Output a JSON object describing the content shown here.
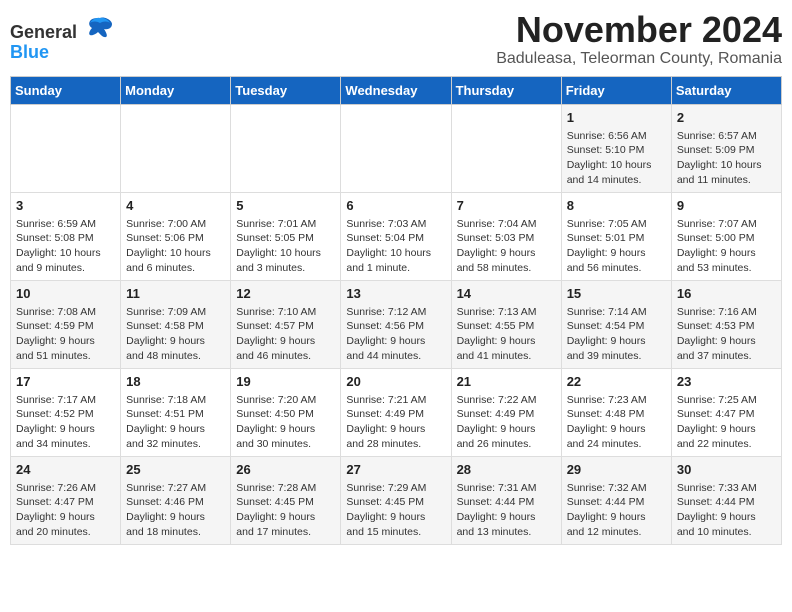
{
  "logo": {
    "general": "General",
    "blue": "Blue"
  },
  "title": "November 2024",
  "subtitle": "Baduleasa, Teleorman County, Romania",
  "days_header": [
    "Sunday",
    "Monday",
    "Tuesday",
    "Wednesday",
    "Thursday",
    "Friday",
    "Saturday"
  ],
  "weeks": [
    [
      {
        "day": "",
        "detail": ""
      },
      {
        "day": "",
        "detail": ""
      },
      {
        "day": "",
        "detail": ""
      },
      {
        "day": "",
        "detail": ""
      },
      {
        "day": "",
        "detail": ""
      },
      {
        "day": "1",
        "detail": "Sunrise: 6:56 AM\nSunset: 5:10 PM\nDaylight: 10 hours and 14 minutes."
      },
      {
        "day": "2",
        "detail": "Sunrise: 6:57 AM\nSunset: 5:09 PM\nDaylight: 10 hours and 11 minutes."
      }
    ],
    [
      {
        "day": "3",
        "detail": "Sunrise: 6:59 AM\nSunset: 5:08 PM\nDaylight: 10 hours and 9 minutes."
      },
      {
        "day": "4",
        "detail": "Sunrise: 7:00 AM\nSunset: 5:06 PM\nDaylight: 10 hours and 6 minutes."
      },
      {
        "day": "5",
        "detail": "Sunrise: 7:01 AM\nSunset: 5:05 PM\nDaylight: 10 hours and 3 minutes."
      },
      {
        "day": "6",
        "detail": "Sunrise: 7:03 AM\nSunset: 5:04 PM\nDaylight: 10 hours and 1 minute."
      },
      {
        "day": "7",
        "detail": "Sunrise: 7:04 AM\nSunset: 5:03 PM\nDaylight: 9 hours and 58 minutes."
      },
      {
        "day": "8",
        "detail": "Sunrise: 7:05 AM\nSunset: 5:01 PM\nDaylight: 9 hours and 56 minutes."
      },
      {
        "day": "9",
        "detail": "Sunrise: 7:07 AM\nSunset: 5:00 PM\nDaylight: 9 hours and 53 minutes."
      }
    ],
    [
      {
        "day": "10",
        "detail": "Sunrise: 7:08 AM\nSunset: 4:59 PM\nDaylight: 9 hours and 51 minutes."
      },
      {
        "day": "11",
        "detail": "Sunrise: 7:09 AM\nSunset: 4:58 PM\nDaylight: 9 hours and 48 minutes."
      },
      {
        "day": "12",
        "detail": "Sunrise: 7:10 AM\nSunset: 4:57 PM\nDaylight: 9 hours and 46 minutes."
      },
      {
        "day": "13",
        "detail": "Sunrise: 7:12 AM\nSunset: 4:56 PM\nDaylight: 9 hours and 44 minutes."
      },
      {
        "day": "14",
        "detail": "Sunrise: 7:13 AM\nSunset: 4:55 PM\nDaylight: 9 hours and 41 minutes."
      },
      {
        "day": "15",
        "detail": "Sunrise: 7:14 AM\nSunset: 4:54 PM\nDaylight: 9 hours and 39 minutes."
      },
      {
        "day": "16",
        "detail": "Sunrise: 7:16 AM\nSunset: 4:53 PM\nDaylight: 9 hours and 37 minutes."
      }
    ],
    [
      {
        "day": "17",
        "detail": "Sunrise: 7:17 AM\nSunset: 4:52 PM\nDaylight: 9 hours and 34 minutes."
      },
      {
        "day": "18",
        "detail": "Sunrise: 7:18 AM\nSunset: 4:51 PM\nDaylight: 9 hours and 32 minutes."
      },
      {
        "day": "19",
        "detail": "Sunrise: 7:20 AM\nSunset: 4:50 PM\nDaylight: 9 hours and 30 minutes."
      },
      {
        "day": "20",
        "detail": "Sunrise: 7:21 AM\nSunset: 4:49 PM\nDaylight: 9 hours and 28 minutes."
      },
      {
        "day": "21",
        "detail": "Sunrise: 7:22 AM\nSunset: 4:49 PM\nDaylight: 9 hours and 26 minutes."
      },
      {
        "day": "22",
        "detail": "Sunrise: 7:23 AM\nSunset: 4:48 PM\nDaylight: 9 hours and 24 minutes."
      },
      {
        "day": "23",
        "detail": "Sunrise: 7:25 AM\nSunset: 4:47 PM\nDaylight: 9 hours and 22 minutes."
      }
    ],
    [
      {
        "day": "24",
        "detail": "Sunrise: 7:26 AM\nSunset: 4:47 PM\nDaylight: 9 hours and 20 minutes."
      },
      {
        "day": "25",
        "detail": "Sunrise: 7:27 AM\nSunset: 4:46 PM\nDaylight: 9 hours and 18 minutes."
      },
      {
        "day": "26",
        "detail": "Sunrise: 7:28 AM\nSunset: 4:45 PM\nDaylight: 9 hours and 17 minutes."
      },
      {
        "day": "27",
        "detail": "Sunrise: 7:29 AM\nSunset: 4:45 PM\nDaylight: 9 hours and 15 minutes."
      },
      {
        "day": "28",
        "detail": "Sunrise: 7:31 AM\nSunset: 4:44 PM\nDaylight: 9 hours and 13 minutes."
      },
      {
        "day": "29",
        "detail": "Sunrise: 7:32 AM\nSunset: 4:44 PM\nDaylight: 9 hours and 12 minutes."
      },
      {
        "day": "30",
        "detail": "Sunrise: 7:33 AM\nSunset: 4:44 PM\nDaylight: 9 hours and 10 minutes."
      }
    ]
  ]
}
